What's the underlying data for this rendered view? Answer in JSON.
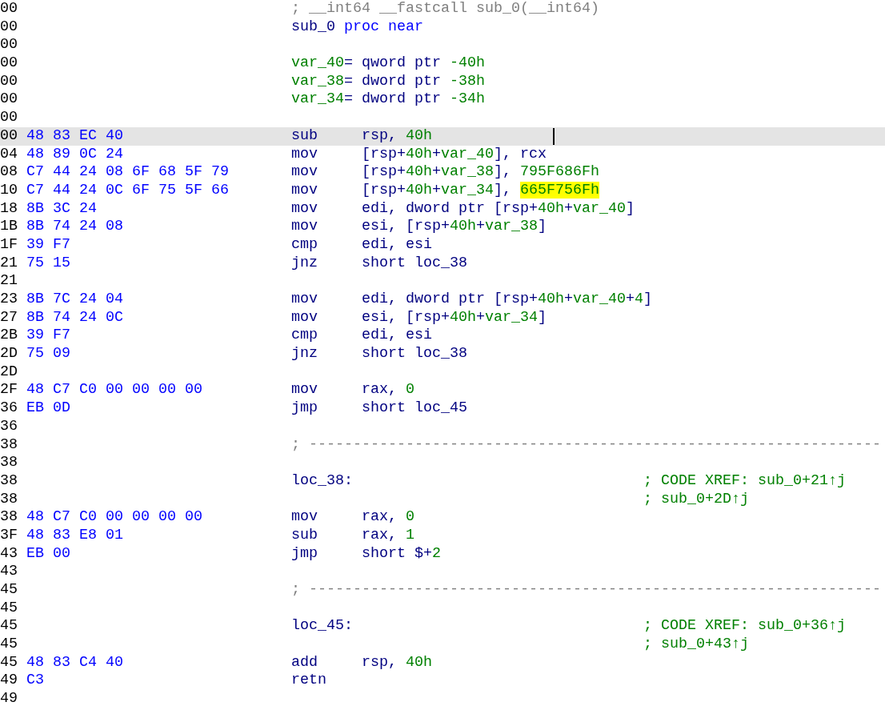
{
  "listing": [
    {
      "address": "00",
      "selected": false,
      "code": [
        {
          "kind": "comment",
          "text": "; __int64 __fastcall sub_0(__int64)"
        }
      ]
    },
    {
      "address": "00",
      "selected": false,
      "code": [
        {
          "kind": "name",
          "text": "sub_0"
        },
        {
          "kind": "keyword",
          "text": " proc near"
        }
      ]
    },
    {
      "address": "00",
      "selected": false
    },
    {
      "address": "00",
      "selected": false,
      "code": [
        {
          "kind": "number",
          "text": "var_40"
        },
        {
          "kind": "name",
          "text": "= qword ptr "
        },
        {
          "kind": "number",
          "text": "-40h"
        }
      ]
    },
    {
      "address": "00",
      "selected": false,
      "code": [
        {
          "kind": "number",
          "text": "var_38"
        },
        {
          "kind": "name",
          "text": "= dword ptr "
        },
        {
          "kind": "number",
          "text": "-38h"
        }
      ]
    },
    {
      "address": "00",
      "selected": false,
      "code": [
        {
          "kind": "number",
          "text": "var_34"
        },
        {
          "kind": "name",
          "text": "= dword ptr "
        },
        {
          "kind": "number",
          "text": "-34h"
        }
      ]
    },
    {
      "address": "00",
      "selected": false
    },
    {
      "address": "00",
      "selected": true,
      "bytes": "48 83 EC 40",
      "mnemonic": "sub",
      "code": [
        {
          "kind": "name",
          "text": "rsp, "
        },
        {
          "kind": "number",
          "text": "40h"
        }
      ]
    },
    {
      "address": "04",
      "selected": false,
      "bytes": "48 89 0C 24",
      "mnemonic": "mov",
      "code": [
        {
          "kind": "name",
          "text": "[rsp+"
        },
        {
          "kind": "number",
          "text": "40h"
        },
        {
          "kind": "name",
          "text": "+"
        },
        {
          "kind": "number",
          "text": "var_40"
        },
        {
          "kind": "name",
          "text": "], rcx"
        }
      ]
    },
    {
      "address": "08",
      "selected": false,
      "bytes": "C7 44 24 08 6F 68 5F 79",
      "mnemonic": "mov",
      "code": [
        {
          "kind": "name",
          "text": "[rsp+"
        },
        {
          "kind": "number",
          "text": "40h"
        },
        {
          "kind": "name",
          "text": "+"
        },
        {
          "kind": "number",
          "text": "var_38"
        },
        {
          "kind": "name",
          "text": "], "
        },
        {
          "kind": "number",
          "text": "795F686Fh"
        }
      ]
    },
    {
      "address": "10",
      "selected": false,
      "bytes": "C7 44 24 0C 6F 75 5F 66",
      "mnemonic": "mov",
      "code": [
        {
          "kind": "name",
          "text": "[rsp+"
        },
        {
          "kind": "number",
          "text": "40h"
        },
        {
          "kind": "name",
          "text": "+"
        },
        {
          "kind": "number",
          "text": "var_34"
        },
        {
          "kind": "name",
          "text": "], "
        },
        {
          "kind": "highlight",
          "text": "665F756Fh"
        }
      ]
    },
    {
      "address": "18",
      "selected": false,
      "bytes": "8B 3C 24",
      "mnemonic": "mov",
      "code": [
        {
          "kind": "name",
          "text": "edi, dword ptr [rsp+"
        },
        {
          "kind": "number",
          "text": "40h"
        },
        {
          "kind": "name",
          "text": "+"
        },
        {
          "kind": "number",
          "text": "var_40"
        },
        {
          "kind": "name",
          "text": "]"
        }
      ]
    },
    {
      "address": "1B",
      "selected": false,
      "bytes": "8B 74 24 08",
      "mnemonic": "mov",
      "code": [
        {
          "kind": "name",
          "text": "esi, [rsp+"
        },
        {
          "kind": "number",
          "text": "40h"
        },
        {
          "kind": "name",
          "text": "+"
        },
        {
          "kind": "number",
          "text": "var_38"
        },
        {
          "kind": "name",
          "text": "]"
        }
      ]
    },
    {
      "address": "1F",
      "selected": false,
      "bytes": "39 F7",
      "mnemonic": "cmp",
      "code": [
        {
          "kind": "name",
          "text": "edi, esi"
        }
      ]
    },
    {
      "address": "21",
      "selected": false,
      "bytes": "75 15",
      "mnemonic": "jnz",
      "code": [
        {
          "kind": "name",
          "text": "short loc_38"
        }
      ]
    },
    {
      "address": "21",
      "selected": false
    },
    {
      "address": "23",
      "selected": false,
      "bytes": "8B 7C 24 04",
      "mnemonic": "mov",
      "code": [
        {
          "kind": "name",
          "text": "edi, dword ptr [rsp+"
        },
        {
          "kind": "number",
          "text": "40h"
        },
        {
          "kind": "name",
          "text": "+"
        },
        {
          "kind": "number",
          "text": "var_40"
        },
        {
          "kind": "name",
          "text": "+"
        },
        {
          "kind": "number",
          "text": "4"
        },
        {
          "kind": "name",
          "text": "]"
        }
      ]
    },
    {
      "address": "27",
      "selected": false,
      "bytes": "8B 74 24 0C",
      "mnemonic": "mov",
      "code": [
        {
          "kind": "name",
          "text": "esi, [rsp+"
        },
        {
          "kind": "number",
          "text": "40h"
        },
        {
          "kind": "name",
          "text": "+"
        },
        {
          "kind": "number",
          "text": "var_34"
        },
        {
          "kind": "name",
          "text": "]"
        }
      ]
    },
    {
      "address": "2B",
      "selected": false,
      "bytes": "39 F7",
      "mnemonic": "cmp",
      "code": [
        {
          "kind": "name",
          "text": "edi, esi"
        }
      ]
    },
    {
      "address": "2D",
      "selected": false,
      "bytes": "75 09",
      "mnemonic": "jnz",
      "code": [
        {
          "kind": "name",
          "text": "short loc_38"
        }
      ]
    },
    {
      "address": "2D",
      "selected": false
    },
    {
      "address": "2F",
      "selected": false,
      "bytes": "48 C7 C0 00 00 00 00",
      "mnemonic": "mov",
      "code": [
        {
          "kind": "name",
          "text": "rax, "
        },
        {
          "kind": "number",
          "text": "0"
        }
      ]
    },
    {
      "address": "36",
      "selected": false,
      "bytes": "EB 0D",
      "mnemonic": "jmp",
      "code": [
        {
          "kind": "name",
          "text": "short loc_45"
        }
      ]
    },
    {
      "address": "36",
      "selected": false
    },
    {
      "address": "38",
      "selected": false,
      "code": [
        {
          "kind": "comment",
          "text": "; -----------------------------------------------------------------"
        }
      ]
    },
    {
      "address": "38",
      "selected": false
    },
    {
      "address": "38",
      "selected": false,
      "code": [
        {
          "kind": "name",
          "text": "loc_38:"
        }
      ],
      "comment": "; CODE XREF: sub_0+21↑j"
    },
    {
      "address": "38",
      "selected": false,
      "comment": "; sub_0+2D↑j"
    },
    {
      "address": "38",
      "selected": false,
      "bytes": "48 C7 C0 00 00 00 00",
      "mnemonic": "mov",
      "code": [
        {
          "kind": "name",
          "text": "rax, "
        },
        {
          "kind": "number",
          "text": "0"
        }
      ]
    },
    {
      "address": "3F",
      "selected": false,
      "bytes": "48 83 E8 01",
      "mnemonic": "sub",
      "code": [
        {
          "kind": "name",
          "text": "rax, "
        },
        {
          "kind": "number",
          "text": "1"
        }
      ]
    },
    {
      "address": "43",
      "selected": false,
      "bytes": "EB 00",
      "mnemonic": "jmp",
      "code": [
        {
          "kind": "name",
          "text": "short $+"
        },
        {
          "kind": "number",
          "text": "2"
        }
      ]
    },
    {
      "address": "43",
      "selected": false
    },
    {
      "address": "45",
      "selected": false,
      "code": [
        {
          "kind": "comment",
          "text": "; -----------------------------------------------------------------"
        }
      ]
    },
    {
      "address": "45",
      "selected": false
    },
    {
      "address": "45",
      "selected": false,
      "code": [
        {
          "kind": "name",
          "text": "loc_45:"
        }
      ],
      "comment": "; CODE XREF: sub_0+36↑j"
    },
    {
      "address": "45",
      "selected": false,
      "comment": "; sub_0+43↑j"
    },
    {
      "address": "45",
      "selected": false,
      "bytes": "48 83 C4 40",
      "mnemonic": "add",
      "code": [
        {
          "kind": "name",
          "text": "rsp, "
        },
        {
          "kind": "number",
          "text": "40h"
        }
      ]
    },
    {
      "address": "49",
      "selected": false,
      "bytes": "C3",
      "mnemonic": "retn"
    },
    {
      "address": "49",
      "selected": false
    }
  ]
}
